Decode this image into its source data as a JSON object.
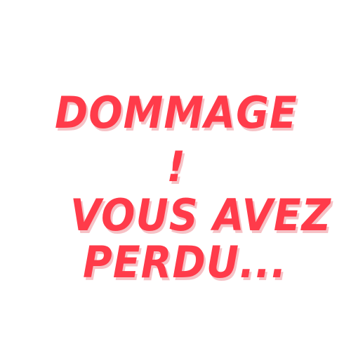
{
  "message": {
    "line1": "DOMMAGE",
    "line2": "!",
    "line3": "VOUS AVEZ",
    "line4": "PERDU..."
  },
  "colors": {
    "text": "#ff3b4a",
    "shadow": "#f6c2c6",
    "background": "#ffffff"
  }
}
